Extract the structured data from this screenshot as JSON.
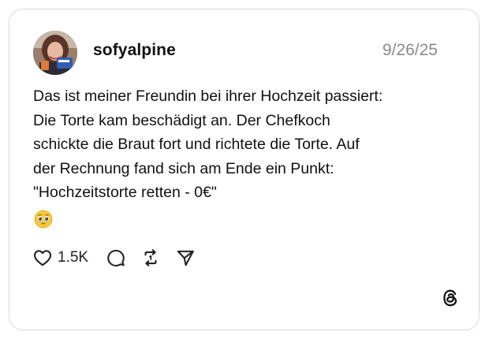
{
  "post": {
    "username": "sofyalpine",
    "date": "9/26/25",
    "text_lines": [
      "Das ist meiner Freundin bei ihrer Hochzeit passiert:",
      "Die Torte kam beschädigt an. Der Chefkoch",
      "schickte die Braut fort und richtete die Torte. Auf",
      "der Rechnung fand sich am Ende ein Punkt:",
      "\"Hochzeitstorte retten - 0€\""
    ],
    "emoji": "🥹"
  },
  "actions": {
    "like_count": "1.5K"
  },
  "icons": {
    "like": "heart-icon",
    "comment": "comment-icon",
    "repost": "repost-icon",
    "share": "send-icon",
    "brand": "threads-logo-icon"
  },
  "colors": {
    "text": "#111111",
    "date": "#8a8a8a",
    "border": "#d9d9d9",
    "icon": "#222222"
  }
}
